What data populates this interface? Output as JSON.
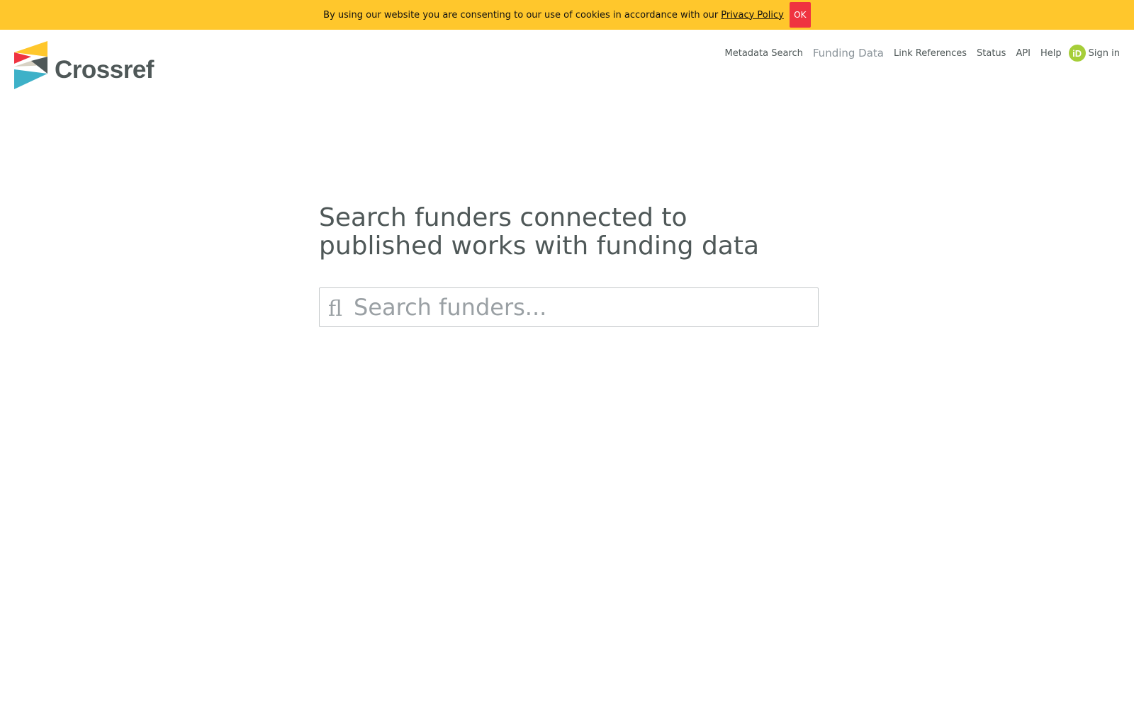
{
  "cookie_bar": {
    "message": "By using our website you are consenting to our use of cookies in accordance with our",
    "link_text": "Privacy Policy",
    "ok_label": "OK"
  },
  "logo": {
    "text": "Crossref"
  },
  "nav": {
    "items": [
      {
        "label": "Metadata Search"
      },
      {
        "label": "Funding Data",
        "active": true
      },
      {
        "label": "Link References"
      },
      {
        "label": "Status"
      },
      {
        "label": "API"
      },
      {
        "label": "Help"
      }
    ],
    "orcid_badge": "iD",
    "signin_label": "Sign in"
  },
  "main": {
    "title": "Search funders connected to published works with funding data",
    "search_placeholder": "Search funders...",
    "search_icon_glyph": "ﬂ"
  },
  "colors": {
    "cookie_bar": "#ffc72c",
    "ok_button": "#ef3340",
    "logo_yellow": "#ffc72c",
    "logo_red": "#ef3340",
    "logo_grey": "#d8d2c4",
    "logo_dark": "#4f5858",
    "logo_blue": "#3eb1c8",
    "orcid_green": "#a6ce39"
  },
  "icons": {
    "logo_mark": "crossref-logo-icon",
    "search": "search-icon",
    "orcid": "orcid-icon"
  }
}
